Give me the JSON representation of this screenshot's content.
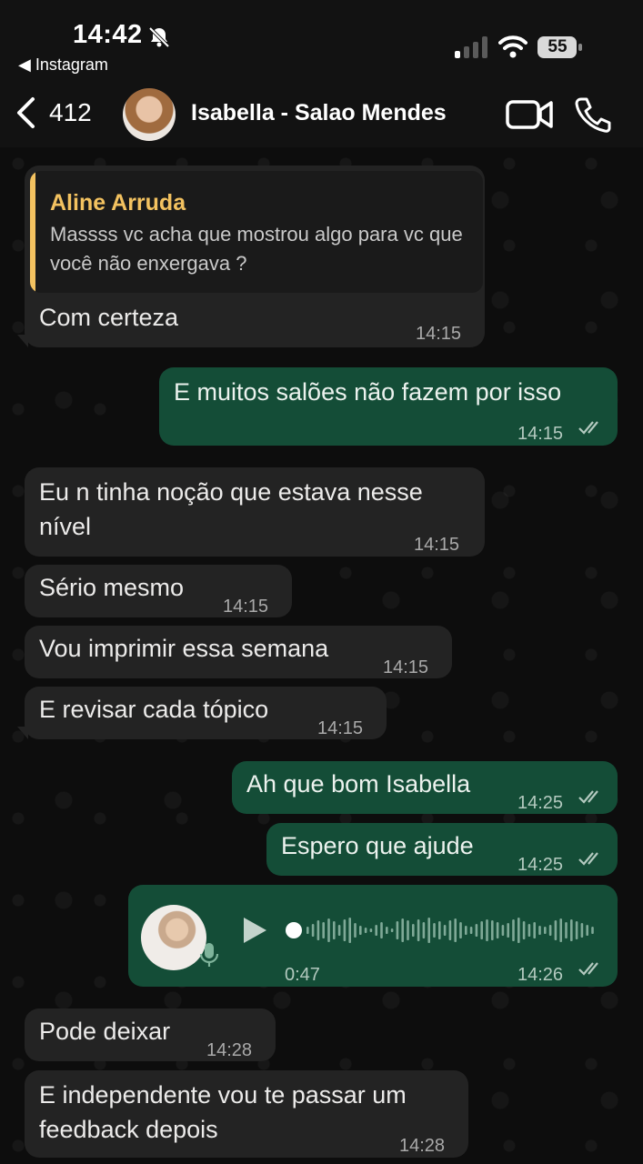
{
  "status_bar": {
    "time": "14:42",
    "back_app": "◀ Instagram",
    "battery": "55"
  },
  "header": {
    "back_count": "412",
    "contact_name": "Isabella - Salao Mendes"
  },
  "messages": [
    {
      "dir": "in",
      "quoted_author": "Aline Arruda",
      "quoted_text": "Massss vc acha que mostrou algo para vc que você não enxergava ?",
      "text": "Com certeza",
      "time": "14:15"
    },
    {
      "dir": "out",
      "text": "E muitos salões não fazem por isso",
      "time": "14:15"
    },
    {
      "dir": "in",
      "text_lines": [
        "Eu n tinha noção que estava nesse",
        "nível"
      ],
      "time": "14:15"
    },
    {
      "dir": "in",
      "text": "Sério mesmo",
      "time": "14:15"
    },
    {
      "dir": "in",
      "text": "Vou imprimir essa semana",
      "time": "14:15"
    },
    {
      "dir": "in",
      "text": "E revisar cada tópico",
      "time": "14:15"
    },
    {
      "dir": "out",
      "text": "Ah que bom Isabella",
      "time": "14:25"
    },
    {
      "dir": "out",
      "text": "Espero que ajude",
      "time": "14:25"
    },
    {
      "dir": "out",
      "type": "voice",
      "duration": "0:47",
      "time": "14:26"
    },
    {
      "dir": "in",
      "text": "Pode deixar",
      "time": "14:28"
    },
    {
      "dir": "in",
      "text_lines": [
        "E independente vou te passar um",
        "feedback depois"
      ],
      "time": "14:28"
    }
  ],
  "colors": {
    "incoming_bubble": "#232323",
    "outgoing_bubble": "#144d37",
    "quote_accent": "#f3c260",
    "read_check": "#b3c9bf"
  },
  "icons": [
    "bell-slash-icon",
    "signal-icon",
    "wifi-icon",
    "battery-icon",
    "chevron-left-icon",
    "video-call-icon",
    "phone-icon",
    "play-icon",
    "mic-icon",
    "double-check-icon"
  ]
}
